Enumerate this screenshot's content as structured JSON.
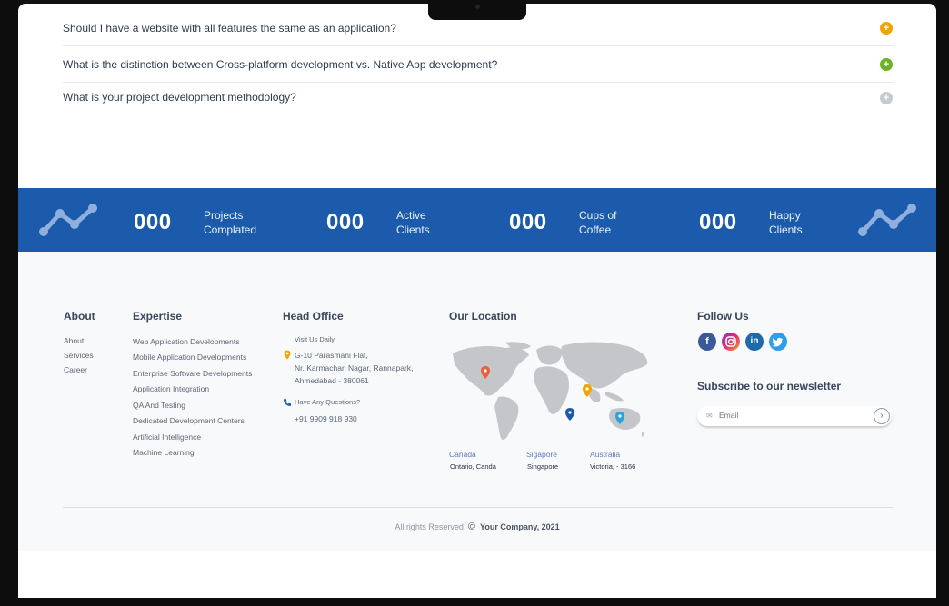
{
  "faq": [
    {
      "question": "Should I have a website with all features the same as an application?",
      "icon": "plus",
      "color": "#f0a500"
    },
    {
      "question": "What is the distinction between Cross-platform development vs. Native App development?",
      "icon": "plus",
      "color": "#6bb324"
    },
    {
      "question": "What is your project development methodology?",
      "icon": "plus",
      "color": "#c7cbd1"
    }
  ],
  "stats": [
    {
      "value": "000",
      "label_line1": "Projects",
      "label_line2": "Complated"
    },
    {
      "value": "000",
      "label_line1": "Active",
      "label_line2": "Clients"
    },
    {
      "value": "000",
      "label_line1": "Cups of",
      "label_line2": "Coffee"
    },
    {
      "value": "000",
      "label_line1": "Happy",
      "label_line2": "Clients"
    }
  ],
  "stats_color": "#1c5bab",
  "about": {
    "heading": "About",
    "links": [
      "About",
      "Services",
      "Career"
    ]
  },
  "expertise": {
    "heading": "Expertise",
    "links": [
      "Web Application Developments",
      "Mobile Application Developments",
      "Enterprise Software Developments",
      "Application Integration",
      "QA And Testing",
      "Dedicated Development Centers",
      "Artificial Intelligence",
      "Machine Learning"
    ]
  },
  "head_office": {
    "heading": "Head Office",
    "visit_label": "Visit Us Daily",
    "address_line1": "G-10 Parasmani Flat,",
    "address_line2": "Nr. Karmachari Nagar, Rannapark,",
    "address_line3": "Ahmedabad - 380061",
    "questions_label": "Have Any Questions?",
    "phone": "+91 9909 918 930"
  },
  "location": {
    "heading": "Our Location",
    "places": [
      {
        "city": "Canada",
        "detail": "Ontario, Canda"
      },
      {
        "city": "Sigapore",
        "detail": "Singapore"
      },
      {
        "city": "Australia",
        "detail": "Victoria, - 3166"
      }
    ]
  },
  "follow": {
    "heading": "Follow Us",
    "icons": [
      "facebook-icon",
      "instagram-icon",
      "linkedin-icon",
      "twitter-icon"
    ]
  },
  "newsletter": {
    "heading": "Subscribe to our newsletter",
    "placeholder": "Email"
  },
  "copyright": {
    "prefix": "All rights Reserved",
    "symbol": "©",
    "company": "Your Company, 2021"
  }
}
